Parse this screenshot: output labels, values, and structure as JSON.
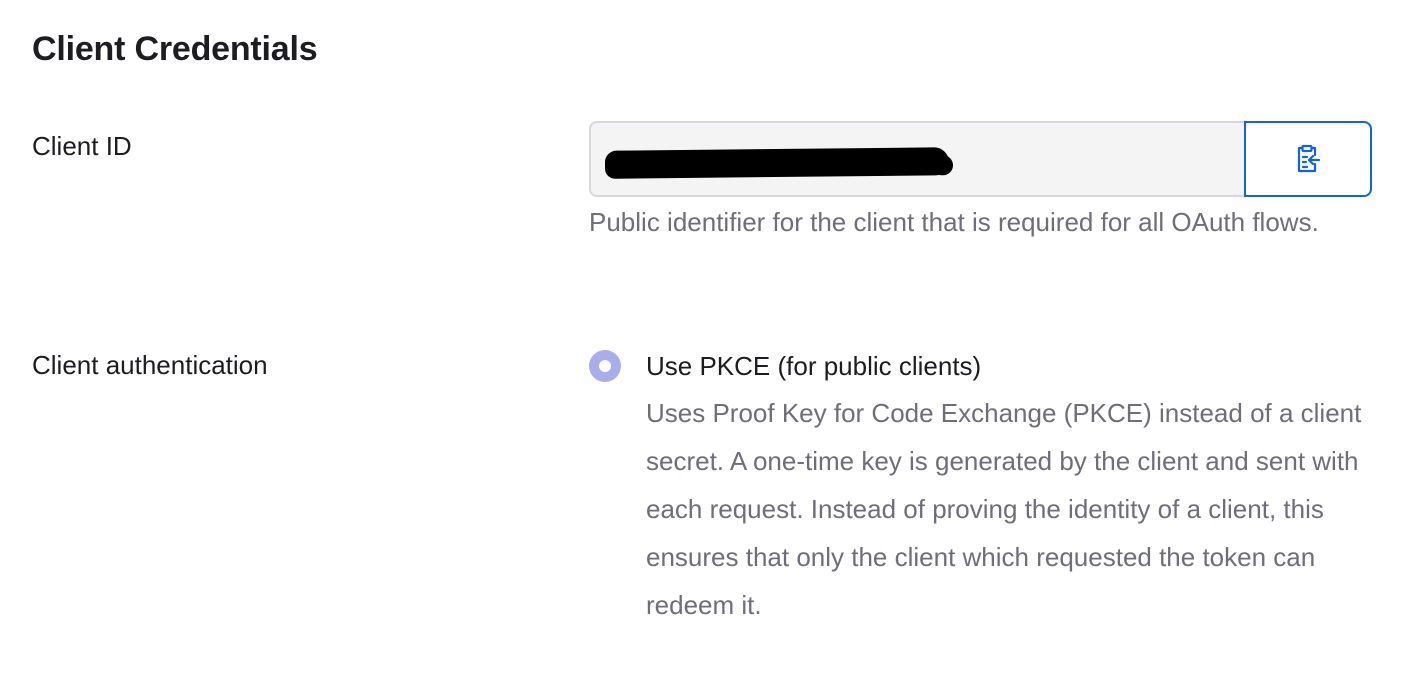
{
  "section": {
    "title": "Client Credentials"
  },
  "client_id": {
    "label": "Client ID",
    "value": "",
    "redacted": true,
    "copy_icon": "clipboard-copy-icon",
    "help_text": "Public identifier for the client that is required for all OAuth flows."
  },
  "client_authentication": {
    "label": "Client authentication",
    "options": [
      {
        "label": "Use PKCE (for public clients)",
        "selected": true,
        "description": "Uses Proof Key for Code Exchange (PKCE) instead of a client secret. A one-time key is generated by the client and sent with each request. Instead of proving the identity of a client, this ensures that only the client which requested the token can redeem it."
      }
    ]
  },
  "colors": {
    "accent": "#1662dd",
    "radio_selected": "#a7aeea",
    "muted_text": "#6e6e78",
    "input_bg": "#f4f4f4"
  }
}
